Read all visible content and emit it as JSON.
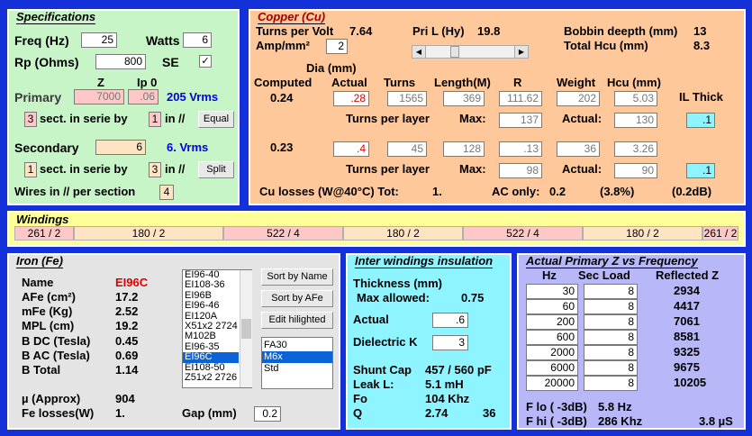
{
  "spec": {
    "title": "Specifications",
    "freq_label": "Freq (Hz)",
    "freq": "25",
    "watts_label": "Watts",
    "watts": "6",
    "rp_label": "Rp (Ohms)",
    "rp": "800",
    "se_label": "SE",
    "se_check": "✓",
    "z_label": "Z",
    "ip_label": "Ip 0",
    "primary_label": "Primary",
    "primary_z": "7000",
    "primary_ip": ".06",
    "primary_vrms": "205 Vrms",
    "pri_sect": "3",
    "sect_text": "sect. in serie by",
    "pri_par": "1",
    "in_par": "in //",
    "equal_btn": "Equal",
    "secondary_label": "Secondary",
    "secondary_z": "6",
    "secondary_vrms": "6. Vrms",
    "sec_sect": "1",
    "sec_par": "3",
    "split_btn": "Split",
    "wires_label": "Wires in // per section",
    "wires": "4"
  },
  "copper": {
    "title": "Copper (Cu)",
    "tpv_label": "Turns per Volt",
    "tpv": "7.64",
    "pril_label": "Pri L (Hy)",
    "pril": "19.8",
    "bobbin_label": "Bobbin deepth (mm)",
    "bobbin": "13",
    "amp_label": "Amp/mm²",
    "amp": "2",
    "total_hcu_label": "Total Hcu (mm)",
    "total_hcu": "8.3",
    "dia_label": "Dia (mm)",
    "headers": {
      "computed": "Computed",
      "actual": "Actual",
      "turns": "Turns",
      "length": "Length(M)",
      "r": "R",
      "weight": "Weight",
      "hcu": "Hcu (mm)",
      "il": "IL Thick"
    },
    "row1": {
      "computed": "0.24",
      "actual": ".28",
      "turns": "1565",
      "length": "369",
      "r": "111.62",
      "weight": "202",
      "hcu": "5.03",
      "il": ".1",
      "tpl_max": "137",
      "tpl_actual": "130"
    },
    "row2": {
      "computed": "0.23",
      "actual": ".4",
      "turns": "45",
      "length": "128",
      "r": ".13",
      "weight": "36",
      "hcu": "3.26",
      "il": ".1",
      "tpl_max": "98",
      "tpl_actual": "90"
    },
    "tpl_label": "Turns per layer",
    "max_label": "Max:",
    "actual_label": "Actual:",
    "losses_label": "Cu losses (W@40°C) Tot:",
    "losses_tot": "1.",
    "ac_label": "AC only:",
    "ac_val": "0.2",
    "ac_pct": "(3.8%)",
    "ac_db": "(0.2dB)"
  },
  "windings": {
    "title": "Windings",
    "segments": [
      {
        "label": "261 / 2",
        "color": "#ffc8c8"
      },
      {
        "label": "180 / 2",
        "color": "#ffe4c4"
      },
      {
        "label": "522 / 4",
        "color": "#ffc8c8"
      },
      {
        "label": "180 / 2",
        "color": "#ffe4c4"
      },
      {
        "label": "522 / 4",
        "color": "#ffc8c8"
      },
      {
        "label": "180 / 2",
        "color": "#ffe4c4"
      },
      {
        "label": "261 / 2",
        "color": "#ffc8c8"
      }
    ]
  },
  "iron": {
    "title": "Iron (Fe)",
    "name_label": "Name",
    "name": "EI96C",
    "afe_label": "AFe (cm²)",
    "afe": "17.2",
    "mfe_label": "mFe (Kg)",
    "mfe": "2.52",
    "mpl_label": "MPL (cm)",
    "mpl": "19.2",
    "bdc_label": "B DC (Tesla)",
    "bdc": "0.45",
    "bac_label": "B AC (Tesla)",
    "bac": "0.69",
    "btot_label": "B Total",
    "btot": "1.14",
    "mu_label": "µ (Approx)",
    "mu": "904",
    "fel_label": "Fe losses(W)",
    "fel": "1.",
    "gap_label": "Gap (mm)",
    "gap": "0.2",
    "cores": [
      "EI96-40",
      "EI108-36",
      "EI96B",
      "EI96-46",
      "EI120A",
      "X51x2 2724",
      "M102B",
      "EI96-35",
      "EI96C",
      "EI108-50",
      "Z51x2 2726"
    ],
    "selected_core": "EI96C",
    "sort_name_btn": "Sort by Name",
    "sort_afe_btn": "Sort by AFe",
    "edit_btn": "Edit hilighted",
    "materials": [
      "FA30",
      "M6x",
      "Std"
    ],
    "selected_material": "M6x"
  },
  "insulation": {
    "title": "Inter windings insulation",
    "thick_label": "Thickness (mm)",
    "max_label": "Max allowed:",
    "max_val": "0.75",
    "actual_label": "Actual",
    "actual": ".6",
    "dielectric_label": "Dielectric K",
    "dielectric": "3",
    "shunt_label": "Shunt Cap",
    "shunt": "457 / 560 pF",
    "leak_label": "Leak L:",
    "leak": "5.1 mH",
    "fo_label": "Fo",
    "fo": "104 Khz",
    "q_label": "Q",
    "q": "2.74",
    "q2": "36"
  },
  "freqresp": {
    "title": "Actual Primary Z vs Frequency",
    "hz_label": "Hz",
    "load_label": "Sec Load",
    "refl_label": "Reflected Z",
    "rows": [
      {
        "hz": "30",
        "load": "8",
        "z": "2934"
      },
      {
        "hz": "60",
        "load": "8",
        "z": "4417"
      },
      {
        "hz": "200",
        "load": "8",
        "z": "7061"
      },
      {
        "hz": "600",
        "load": "8",
        "z": "8581"
      },
      {
        "hz": "2000",
        "load": "8",
        "z": "9325"
      },
      {
        "hz": "6000",
        "load": "8",
        "z": "9675"
      },
      {
        "hz": "20000",
        "load": "8",
        "z": "10205"
      }
    ],
    "flo_label": "F lo ( -3dB)",
    "flo": "5.8 Hz",
    "fhi_label": "F hi ( -3dB)",
    "fhi": "286 Khz",
    "us": "3.8 µS"
  },
  "colors": {
    "spec_bg": "#c8f5c8",
    "copper_bg": "#ffc89a",
    "windings_bg": "#ffff9a",
    "iron_bg": "#e4e4e4",
    "insul_bg": "#8ef4ff",
    "freq_bg": "#b8b8f8"
  }
}
